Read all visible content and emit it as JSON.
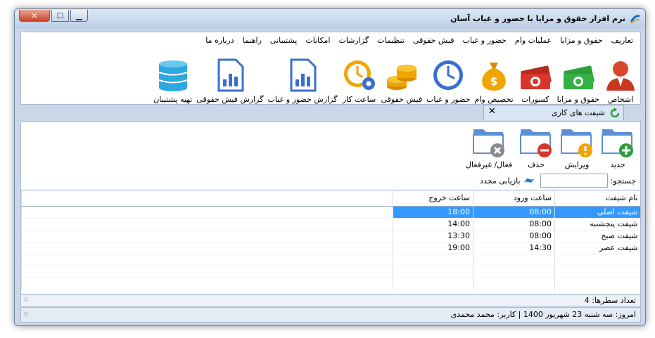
{
  "window": {
    "title": "نرم افزار حقوق و مزایا با حضور و غیاب آسان",
    "controls": {
      "close": "✕",
      "maximize": "☐",
      "minimize": "▁"
    }
  },
  "menu": [
    "تعاریف",
    "حقوق و مزایا",
    "عملیات وام",
    "حضور و غیاب",
    "فیش حقوقی",
    "تنظیمات",
    "گزارشات",
    "امکانات",
    "پشتیبانی",
    "راهنما",
    "درباره ما"
  ],
  "toolbar": [
    {
      "label": "اشخاص",
      "icon": "person-icon"
    },
    {
      "label": "حقوق و مزایا",
      "icon": "money-bill-icon"
    },
    {
      "label": "کسورات",
      "icon": "money-bill-red-icon"
    },
    {
      "label": "تخصیص وام",
      "icon": "money-bag-icon"
    },
    {
      "label": "حضور و غیاب",
      "icon": "clock-icon"
    },
    {
      "label": "فیش حقوقی",
      "icon": "coins-icon"
    },
    {
      "label": "ساعت کار",
      "icon": "clock-gear-icon"
    },
    {
      "label": "گزارش حضور و غیاب",
      "icon": "report-icon"
    },
    {
      "label": "گزارش فیش حقوقی",
      "icon": "report-icon"
    },
    {
      "label": "تهیه پشتیبان",
      "icon": "database-icon"
    }
  ],
  "tab": {
    "label": "شیفت های کاری",
    "close": "✕"
  },
  "actions": {
    "new": "جدید",
    "edit": "ویرایش",
    "delete": "حذف",
    "toggle": "فعال/ غیرفعال"
  },
  "search": {
    "label": "جستجو:",
    "value": "",
    "refresh": "بازیابی مجدد"
  },
  "grid": {
    "columns": [
      "نام شیفت",
      "ساعت ورود",
      "ساعت خروج"
    ],
    "rows": [
      [
        "شیفت اصلی",
        "08:00",
        "18:00"
      ],
      [
        "شیفت پنجشنبه",
        "08:00",
        "14:00"
      ],
      [
        "شیفت صبح",
        "08:00",
        "13:30"
      ],
      [
        "شیفت عصر",
        "14:30",
        "19:00"
      ]
    ],
    "selected_row": 0
  },
  "row_count": {
    "label": "تعداد سطرها:",
    "value": "4"
  },
  "status": {
    "text": "امروز: سه شنبه 23 شهریور 1400  |  کاربر: محمد محمدی"
  },
  "colors": {
    "accent": "#3399ff",
    "folder": "#5b8fd8",
    "green": "#2e9e3a",
    "red": "#d9362a",
    "orange": "#f0a500"
  }
}
